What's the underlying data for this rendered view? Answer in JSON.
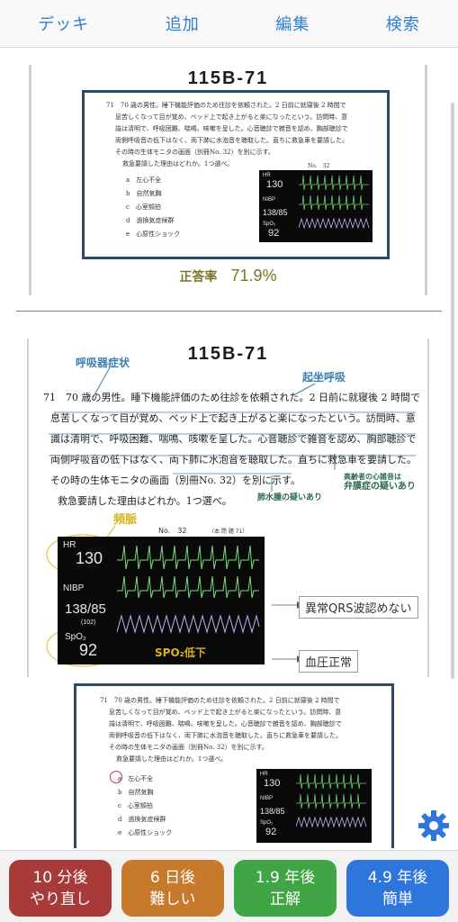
{
  "nav": {
    "deck": "デッキ",
    "add": "追加",
    "edit": "編集",
    "search": "検索"
  },
  "card1": {
    "title": "115B-71",
    "question_lines": [
      "71　70 歳の男性。睡下機能評価のため往診を依頼された。2 日前に就寝後 2 時間で",
      "息苦しくなって目が覚め、ベッド上で起き上がると楽になったという。訪問時、意",
      "識は清明で、呼吸困難、喘鳴、咳嗽を呈した。心音聴診で雑音を認め、胸部聴診で",
      "両側呼吸音の低下はなく、両下肺に水泡音を聴取した。直ちに救急車を要請した。",
      "その時の生体モニタの画面（別冊No. 32）を別に示す。",
      "救急要請した理由はどれか。1つ選べ。"
    ],
    "options": [
      "a　左心不全",
      "b　自然気胸",
      "c　心室頻拍",
      "d　過換気症候群",
      "e　心原性ショック"
    ],
    "figure_no": "No.　32",
    "monitor": {
      "hr_label": "HR",
      "hr": "130",
      "nibp_label": "NIBP",
      "nibp": "138/85",
      "spo2_label": "SpO₂",
      "spo2": "92"
    },
    "rate_label": "正答率",
    "rate_value": "71.9%"
  },
  "card2": {
    "title": "115B-71",
    "question_lines": [
      "71　70 歳の男性。睡下機能評価のため往診を依頼された。2 日前に就寝後 2 時間で",
      "息苦しくなって目が覚め、ベッド上で起き上がると楽になったという。訪問時、意",
      "識は清明で、呼吸困難、喘鳴、咳嗽を呈した。心音聴診で雑音を認め、胸部聴診で",
      "両側呼吸音の低下はなく、両下肺に水泡音を聴取した。直ちに救急車を要請した。",
      "その時の生体モニタの画面（別冊No. 32）を別に示す。",
      "救急要請した理由はどれか。1つ選べ。"
    ],
    "annotations": {
      "respiratory": "呼吸器症状",
      "orthopnea": "起坐呼吸",
      "valve_1": "高齢者の心雑音は",
      "valve_2": "弁膜症の疑いあり",
      "edema": "肺水腫の疑いあり",
      "tachy": "頻脈",
      "qrs": "異常QRS波認めない",
      "bp": "血圧正常",
      "spo2": "SPO₂低下"
    },
    "figure_no": "No.　32",
    "figure_ref": "（本 問 題 71）",
    "monitor": {
      "hr_label": "HR",
      "hr": "130",
      "nibp_label": "NIBP",
      "nibp": "138/85",
      "nibp_mean": "(102)",
      "spo2_label": "SpO₂",
      "spo2": "92"
    }
  },
  "card3": {
    "question_lines": [
      "71　70 歳の男性。睡下機能評価のため往診を依頼された。2 日前に就寝後 2 時間で",
      "息苦しくなって目が覚め、ベッド上で起き上がると楽になったという。訪問時、意",
      "識は清明で、呼吸困難、喘鳴、咳嗽を呈した。心音聴診で雑音を認め、胸部聴診で",
      "両側呼吸音の低下はなく、両下肺に水泡音を聴取した。直ちに救急車を要請した。",
      "その時の生体モニタの画面（別冊No. 32）を別に示す。",
      "救急要請した理由はどれか。1つ選べ。"
    ],
    "options": [
      "a　左心不全",
      "b　自然気胸",
      "c　心室頻拍",
      "d　過換気症候群",
      "e　心原性ショック"
    ],
    "monitor": {
      "hr_label": "HR",
      "hr": "130",
      "nibp_label": "NIBP",
      "nibp": "138/85",
      "spo2_label": "SpO₂",
      "spo2": "92"
    }
  },
  "buttons": [
    {
      "line1": "10 分後",
      "line2": "やり直し",
      "color": "#a83a3a"
    },
    {
      "line1": "6 日後",
      "line2": "難しい",
      "color": "#c77a2c"
    },
    {
      "line1": "1.9 年後",
      "line2": "正解",
      "color": "#3fa545"
    },
    {
      "line1": "4.9 年後",
      "line2": "簡単",
      "color": "#2f76dc"
    }
  ],
  "colors": {
    "nav_text": "#2f7fd0",
    "gear": "#2f76dc",
    "rate": "#7a7628"
  }
}
